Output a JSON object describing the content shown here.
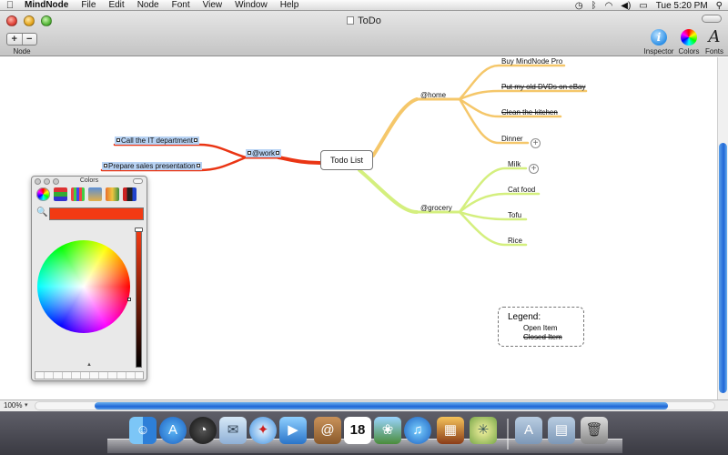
{
  "menubar": {
    "app_name": "MindNode",
    "menus": [
      "File",
      "Edit",
      "Node",
      "Font",
      "View",
      "Window",
      "Help"
    ],
    "clock": "Tue 5:20 PM"
  },
  "window": {
    "title": "ToDo",
    "toolbar": {
      "node_add": "+",
      "node_remove": "−",
      "node_label": "Node",
      "inspector_label": "Inspector",
      "colors_label": "Colors",
      "fonts_label": "Fonts",
      "fonts_glyph": "A",
      "inspector_glyph": "i"
    },
    "status": {
      "zoom": "100%"
    }
  },
  "mindmap": {
    "root": "Todo List",
    "branches": {
      "home": {
        "label": "@home",
        "color": "#f5c76a",
        "items": [
          {
            "label": "Buy MindNode Pro",
            "closed": false
          },
          {
            "label": "Put my old DVDs on eBay",
            "closed": true
          },
          {
            "label": "Clean the kitchen",
            "closed": true
          },
          {
            "label": "Dinner",
            "closed": false,
            "collapsed": true
          }
        ]
      },
      "grocery": {
        "label": "@grocery",
        "color": "#d4ef7e",
        "items": [
          {
            "label": "Milk",
            "closed": false,
            "collapsed": true
          },
          {
            "label": "Cat food",
            "closed": false
          },
          {
            "label": "Tofu",
            "closed": false
          },
          {
            "label": "Rice",
            "closed": false
          }
        ]
      },
      "work": {
        "label": "@work",
        "color": "#ea3514",
        "items": [
          {
            "label": "Call the IT department"
          },
          {
            "label": "Prepare sales presentation"
          }
        ]
      }
    },
    "legend": {
      "title": "Legend:",
      "open": "Open Item",
      "closed": "Closed Item"
    }
  },
  "colors_panel": {
    "title": "Colors",
    "current_color": "#f23a13"
  },
  "dock": {
    "apps": [
      "finder-icon",
      "app-store-icon",
      "dashboard-icon",
      "mail-icon",
      "safari-icon",
      "facetime-icon",
      "address-book-icon",
      "ical-icon",
      "iphoto-icon",
      "itunes-icon",
      "preview-icon",
      "mindnode-icon",
      "applications-folder-icon",
      "documents-folder-icon",
      "trash-icon"
    ]
  }
}
